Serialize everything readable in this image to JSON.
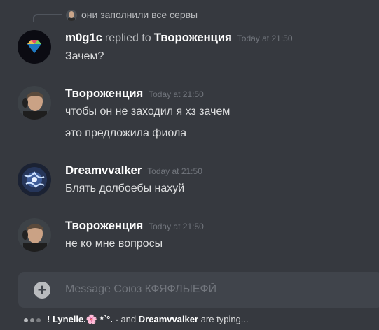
{
  "reply_ref": {
    "text": "они заполнили все сервы",
    "avatar_icon": "portrait-avatar-icon"
  },
  "messages": [
    {
      "author": "m0g1c",
      "replied_to_label": "replied to",
      "replied_to": "Твороженция",
      "timestamp": "Today at 21:50",
      "avatar_icon": "diamond-avatar-icon",
      "lines": [
        "Зачем?"
      ]
    },
    {
      "author": "Твороженция",
      "timestamp": "Today at 21:50",
      "avatar_icon": "portrait-avatar-icon",
      "lines": [
        "чтобы он не заходил я хз зачем",
        "это предложила фиола"
      ]
    },
    {
      "author": "Dreamvvalker",
      "timestamp": "Today at 21:50",
      "avatar_icon": "lightning-orb-avatar-icon",
      "lines": [
        "Блять долбоебы нахуй"
      ]
    },
    {
      "author": "Твороженция",
      "timestamp": "Today at 21:50",
      "avatar_icon": "portrait-avatar-icon",
      "lines": [
        "не ко мне вопросы"
      ]
    }
  ],
  "composer": {
    "placeholder": "Message Союз КФЯФЛЫЕФЙ",
    "add_icon": "plus-circle-icon"
  },
  "typing": {
    "user1": "! Lynelle.",
    "user1_emoji": "🌸",
    "user2": "*˚°. -",
    "and_label": "and",
    "user3": "Dreamvvalker",
    "suffix": "are typing..."
  },
  "colors": {
    "background": "#36393f",
    "composer": "#40444b",
    "author": "#ffffff",
    "text": "#dcddde",
    "muted": "#72767d"
  }
}
